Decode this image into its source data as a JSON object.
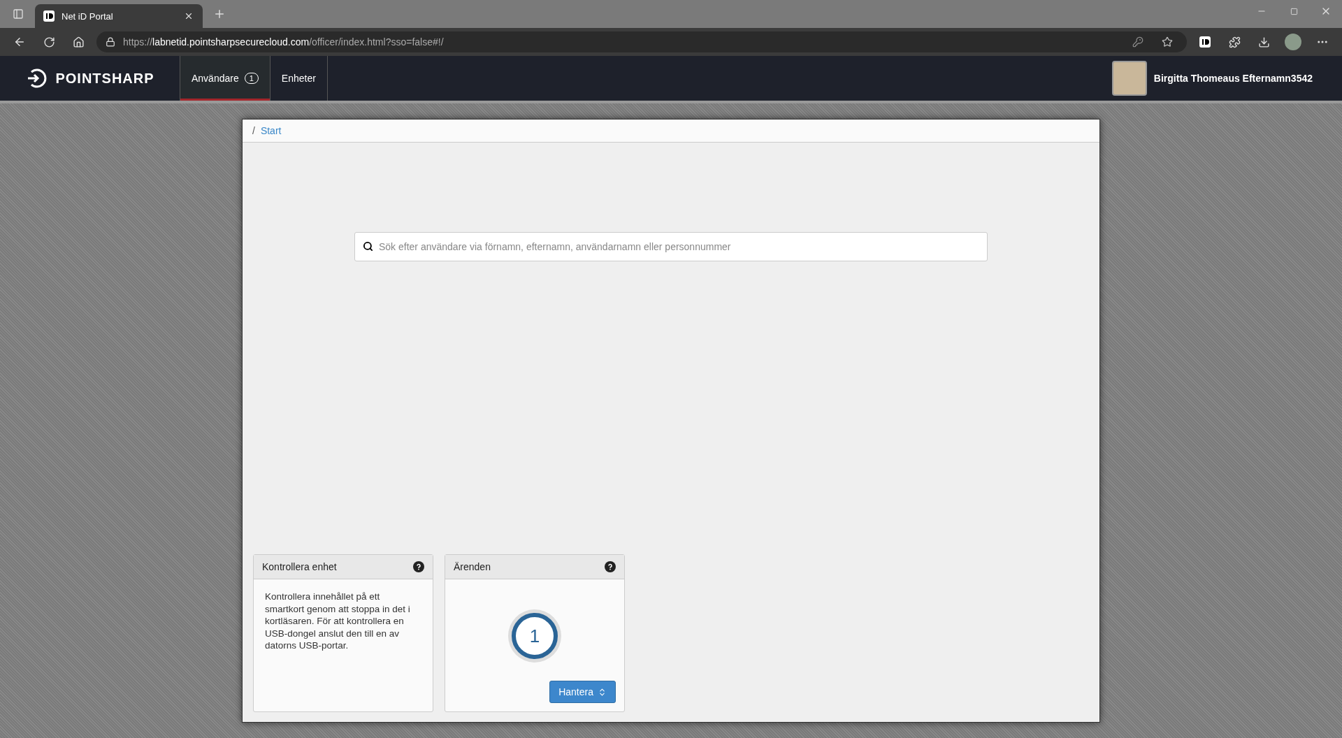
{
  "browser": {
    "tab": {
      "title": "Net iD Portal",
      "selected": true
    },
    "url": {
      "scheme": "https://",
      "host": "labnetid.pointsharpsecurecloud.com",
      "path": "/officer/index.html?sso=false#!/"
    }
  },
  "header": {
    "logo": "POINTSHARP",
    "nav": [
      {
        "label": "Användare",
        "badge": "1",
        "selected": true
      },
      {
        "label": "Enheter",
        "selected": false
      }
    ],
    "user": {
      "name": "Birgitta Thomeaus Efternamn3542"
    }
  },
  "breadcrumb": [
    {
      "separator": "/",
      "label": "Start"
    }
  ],
  "search": {
    "placeholder": "Sök efter användare via förnamn, efternamn, användarnamn eller personnummer"
  },
  "panels": [
    {
      "kind": "text",
      "title": "Kontrollera enhet",
      "body": "Kontrollera innehållet på ett smartkort genom att stoppa in det i kortläsaren. För att kontrollera en USB-dongel anslut den till en av datorns USB-portar."
    },
    {
      "kind": "counter",
      "title": "Ärenden",
      "count": "1",
      "button": "Hantera"
    }
  ]
}
